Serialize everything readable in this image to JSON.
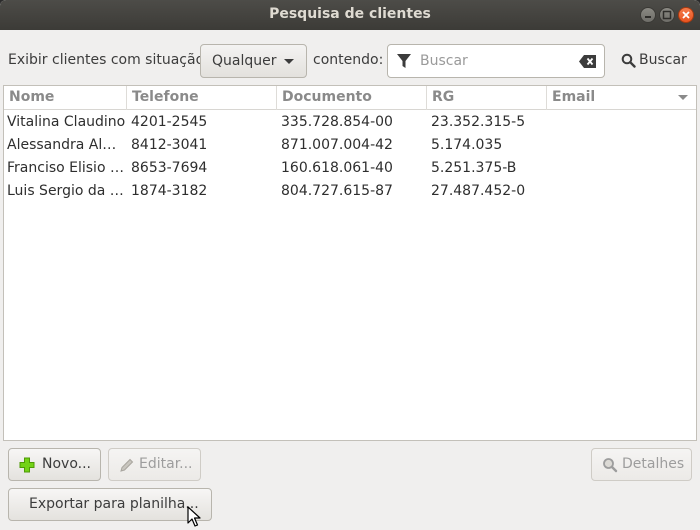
{
  "window": {
    "title": "Pesquisa de clientes",
    "controls": [
      "minimize",
      "maximize",
      "close"
    ]
  },
  "filter": {
    "situacao_label": "Exibir clientes com situação",
    "situacao_value": "Qualquer",
    "contendo_label": "contendo:",
    "search_placeholder": "Buscar",
    "search_value": "",
    "search_button": "Buscar"
  },
  "table": {
    "columns": [
      "Nome",
      "Telefone",
      "Documento",
      "RG",
      "Email"
    ],
    "rows": [
      [
        "Vitalina Claudino",
        "4201-2545",
        "335.728.854-00",
        "23.352.315-5",
        ""
      ],
      [
        "Alessandra Al…",
        "8412-3041",
        "871.007.004-42",
        "5.174.035",
        ""
      ],
      [
        "Franciso Elisio …",
        "8653-7694",
        "160.618.061-40",
        "5.251.375-B",
        ""
      ],
      [
        "Luis Sergio da …",
        "1874-3182",
        "804.727.615-87",
        "27.487.452-0",
        ""
      ]
    ]
  },
  "actions": {
    "novo": "Novo...",
    "editar": "Editar...",
    "detalhes": "Detalhes",
    "exportar": "Exportar para planilha..."
  },
  "colors": {
    "titlebar": "#3c3b37",
    "close_button": "#e95420",
    "window_bg": "#f0efee",
    "add_icon": "#4e9a06"
  }
}
